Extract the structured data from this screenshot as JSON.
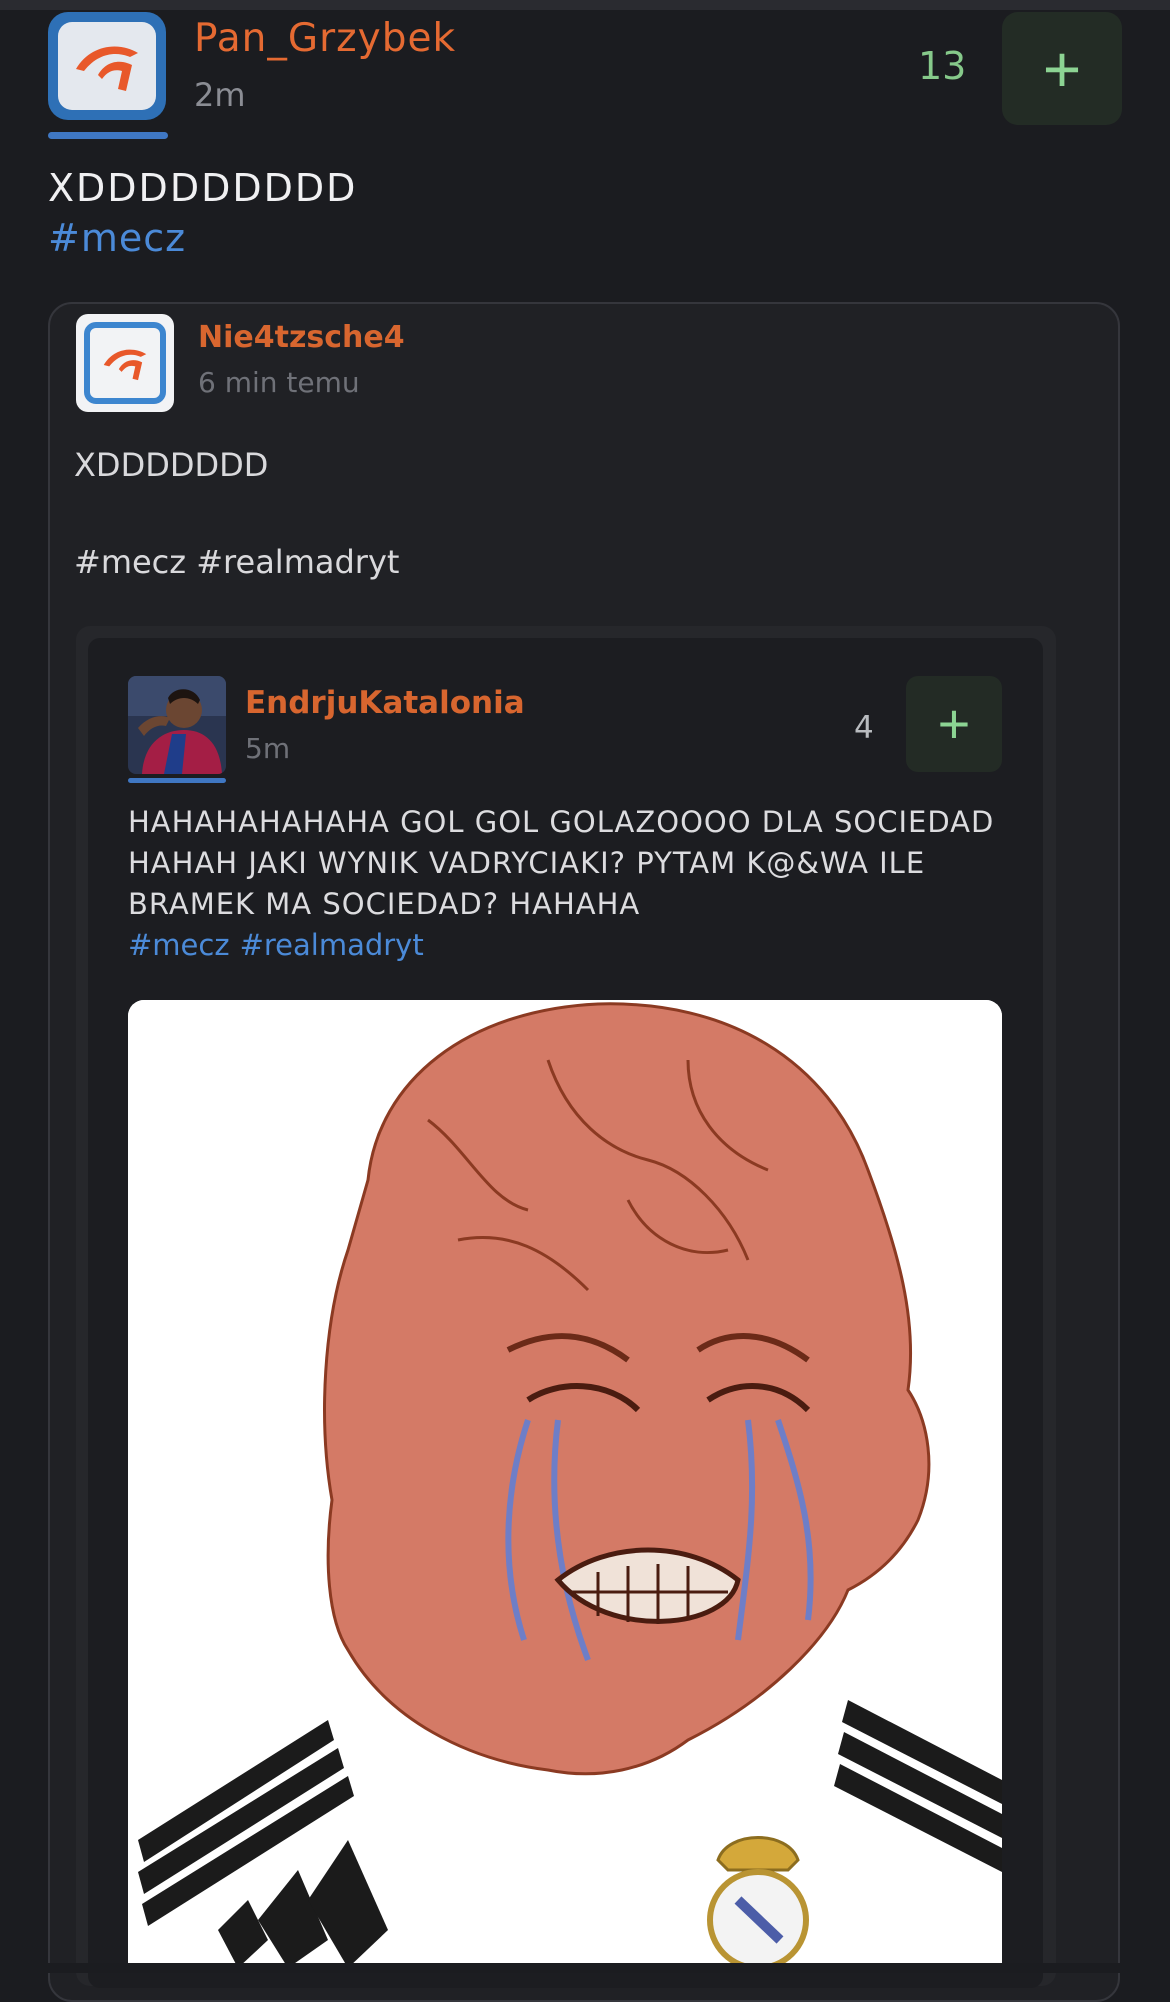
{
  "post": {
    "username": "Pan_Grzybek",
    "time": "2m",
    "score": "13",
    "plus_label": "+",
    "text": "XDDDDDDDDD",
    "tag": "#mecz"
  },
  "quoted_post": {
    "username": "Nie4tzsche4",
    "time": "6 min temu",
    "text": "XDDDDDDD",
    "tags": "#mecz #realmadryt",
    "nested_post": {
      "username": "EndrjuKatalonia",
      "time": "5m",
      "score": "4",
      "plus_label": "+",
      "text": "HAHAHAHAHAHA GOL GOL GOLAZOOOO DLA SOCIEDAD HAHAH JAKI WYNIK VADRYCIAKI? PYTAM K@&WA ILE BRAMEK MA SOCIEDAD? HAHAHA",
      "tags": [
        "#mecz",
        "#realmadryt"
      ]
    }
  },
  "colors": {
    "background": "#1b1c20",
    "username": "#e56a32",
    "hashtag": "#4b8ad8",
    "score_green": "#86c98a"
  },
  "icons": {
    "app_logo": "bird-logo-icon",
    "plus": "plus-icon"
  }
}
